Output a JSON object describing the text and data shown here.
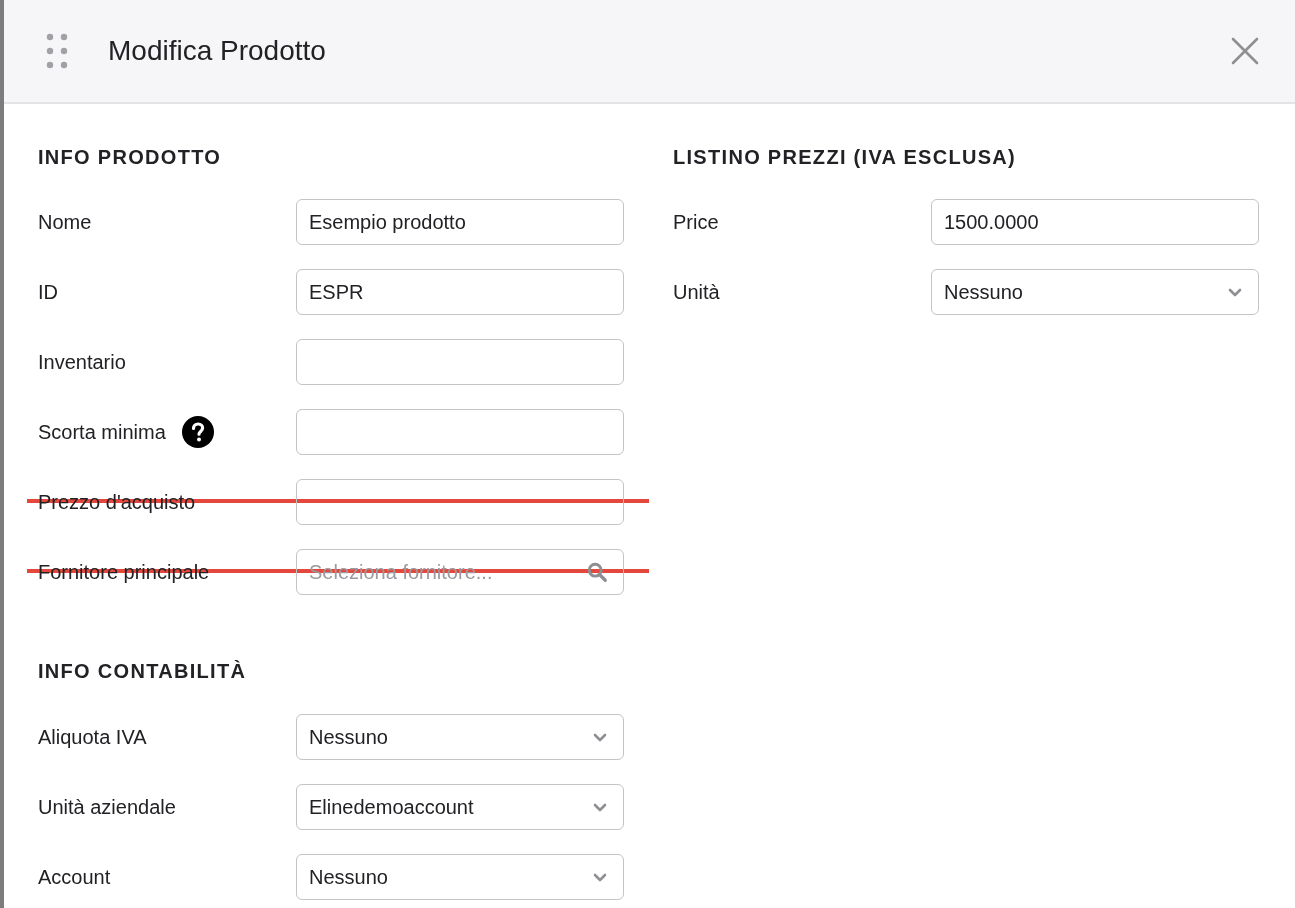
{
  "window": {
    "title": "Modifica Prodotto"
  },
  "sections": [
    {
      "title": "INFO PRODOTTO",
      "fields": [
        {
          "label": "Nome",
          "kind": "text",
          "value": "Esempio prodotto",
          "struck": false
        },
        {
          "label": "ID",
          "kind": "text",
          "value": "ESPR",
          "struck": false
        },
        {
          "label": "Inventario",
          "kind": "text",
          "struck": false
        },
        {
          "label": "Scorta minima",
          "kind": "text",
          "help": true,
          "struck": false
        },
        {
          "label": "Prezzo d'acquisto",
          "kind": "text",
          "struck": true
        },
        {
          "label": "Fornitore principale",
          "kind": "search",
          "placeholder": "Seleziona fornitore...",
          "struck": true
        }
      ]
    },
    {
      "title": "INFO CONTABILITÀ",
      "fields": [
        {
          "label": "Aliquota IVA",
          "kind": "select",
          "value": "Nessuno",
          "struck": false
        },
        {
          "label": "Unità aziendale",
          "kind": "select",
          "value": "Elinedemoaccount",
          "struck": false
        },
        {
          "label": "Account",
          "kind": "select",
          "value": "Nessuno",
          "struck": false
        }
      ]
    }
  ],
  "price_section": {
    "title": "LISTINO PREZZI (IVA ESCLUSA)",
    "fields": [
      {
        "label": "Price",
        "kind": "text",
        "value": "1500.0000",
        "struck": false
      },
      {
        "label": "Unità",
        "kind": "select",
        "value": "Nessuno",
        "struck": false
      }
    ]
  }
}
